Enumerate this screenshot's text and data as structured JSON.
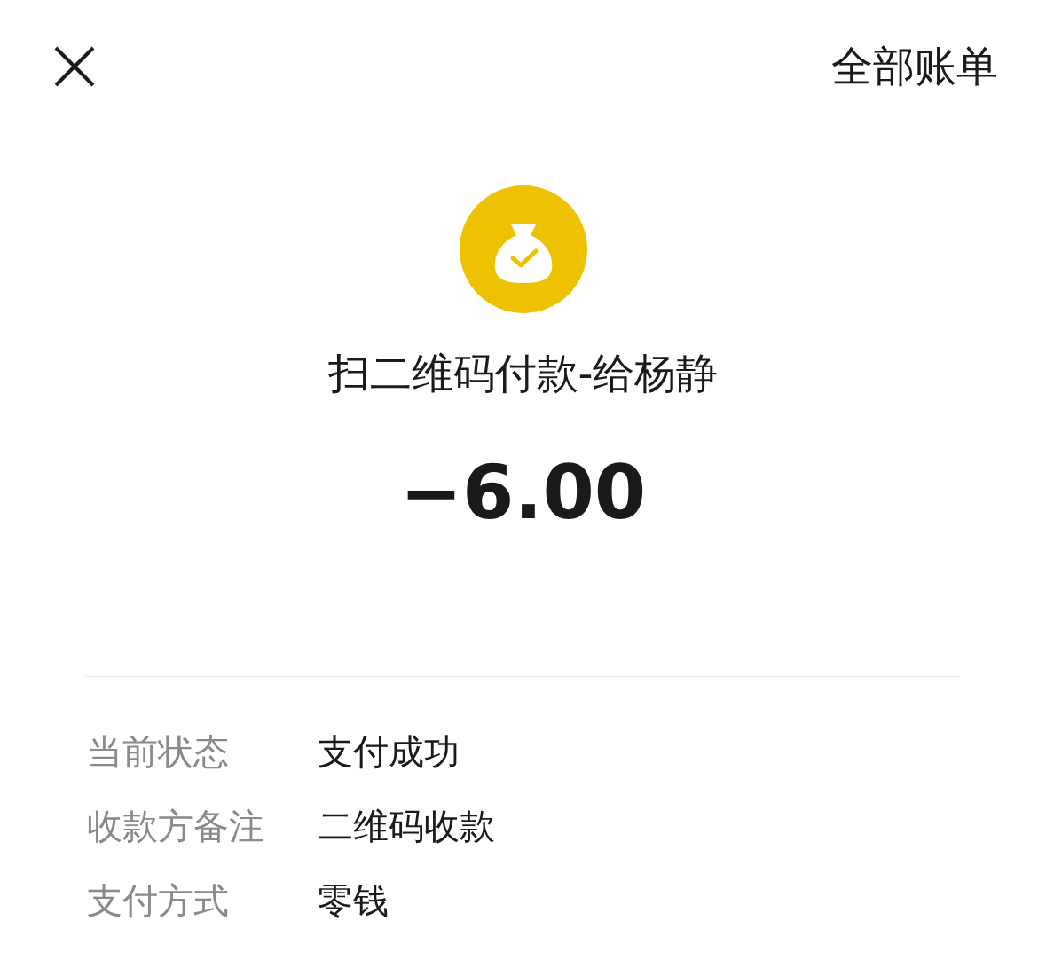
{
  "header": {
    "action": "全部账单"
  },
  "payment": {
    "title": "扫二维码付款-给杨静",
    "amount": "−6.00"
  },
  "details": [
    {
      "label": "当前状态",
      "value": "支付成功"
    },
    {
      "label": "收款方备注",
      "value": "二维码收款"
    },
    {
      "label": "支付方式",
      "value": "零钱"
    }
  ]
}
